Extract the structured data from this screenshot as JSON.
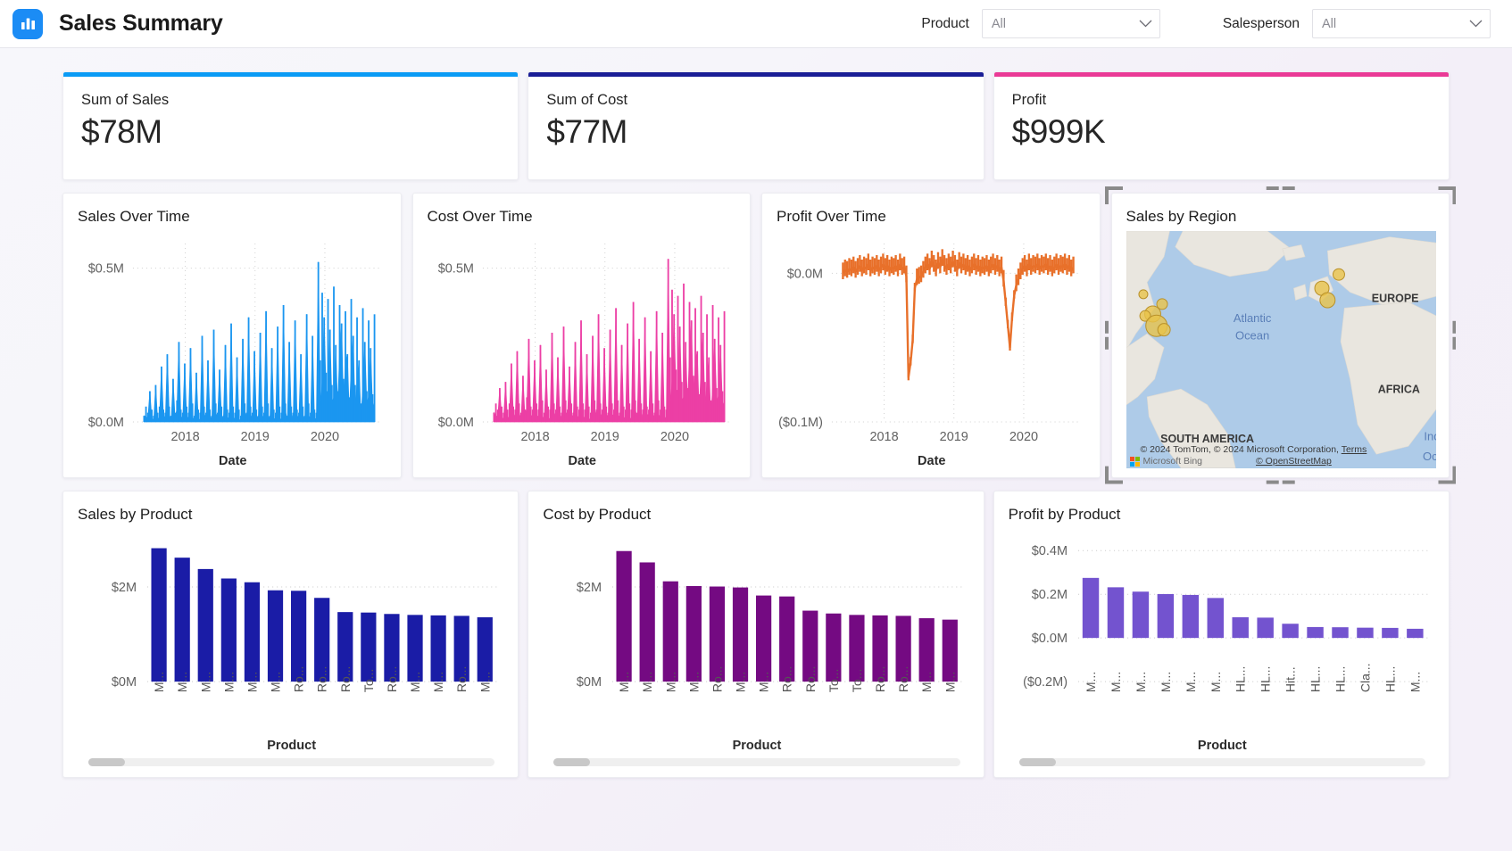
{
  "header": {
    "logo_icon": "bar-chart-icon",
    "title": "Sales Summary",
    "filters": [
      {
        "label": "Product",
        "value": "All",
        "chevron_icon": "chevron-down-icon"
      },
      {
        "label": "Salesperson",
        "value": "All",
        "chevron_icon": "chevron-down-icon"
      }
    ]
  },
  "kpis": [
    {
      "label": "Sum of Sales",
      "value": "$78M",
      "accent": "#0a9bf5"
    },
    {
      "label": "Sum of Cost",
      "value": "$77M",
      "accent": "#1a1e96"
    },
    {
      "label": "Profit",
      "value": "$999K",
      "accent": "#ea3a96"
    }
  ],
  "map": {
    "title": "Sales by Region",
    "labels": [
      "EUROPE",
      "AFRICA",
      "SOUTH AMERICA",
      "Atlantic Ocean",
      "Indian Ocean"
    ],
    "attribution_line1": "© 2024 TomTom, © 2024 Microsoft Corporation,",
    "attribution_terms": "Terms",
    "attribution_brand": "Microsoft Bing",
    "attribution_osm": "© OpenStreetMap",
    "selected": true
  },
  "chart_data": [
    {
      "id": "sales-over-time",
      "type": "area",
      "title": "Sales Over Time",
      "xlabel": "Date",
      "ylabel": "",
      "color": "#1b96f0",
      "yticks": [
        "$0.0M",
        "$0.5M"
      ],
      "ylim": [
        0,
        0.58
      ],
      "xticks": [
        "2018",
        "2019",
        "2020"
      ],
      "grid": true,
      "series_note": "daily sales, noisy, rising trend with spike near mid-2019",
      "values": [
        0.02,
        0.05,
        0.03,
        0.1,
        0.04,
        0.02,
        0.12,
        0.03,
        0.05,
        0.18,
        0.04,
        0.03,
        0.22,
        0.05,
        0.02,
        0.14,
        0.03,
        0.07,
        0.26,
        0.04,
        0.03,
        0.19,
        0.05,
        0.03,
        0.24,
        0.06,
        0.02,
        0.16,
        0.04,
        0.03,
        0.28,
        0.05,
        0.03,
        0.2,
        0.04,
        0.02,
        0.3,
        0.06,
        0.03,
        0.17,
        0.05,
        0.02,
        0.25,
        0.04,
        0.03,
        0.32,
        0.05,
        0.03,
        0.21,
        0.04,
        0.02,
        0.27,
        0.06,
        0.03,
        0.34,
        0.05,
        0.03,
        0.23,
        0.04,
        0.02,
        0.29,
        0.05,
        0.03,
        0.36,
        0.06,
        0.02,
        0.24,
        0.04,
        0.03,
        0.31,
        0.05,
        0.03,
        0.38,
        0.06,
        0.02,
        0.26,
        0.05,
        0.03,
        0.33,
        0.04,
        0.03,
        0.22,
        0.05,
        0.02,
        0.35,
        0.06,
        0.03,
        0.28,
        0.04,
        0.03,
        0.52,
        0.2,
        0.42,
        0.34,
        0.16,
        0.4,
        0.3,
        0.12,
        0.44,
        0.25,
        0.1,
        0.38,
        0.32,
        0.14,
        0.36,
        0.22,
        0.08,
        0.4,
        0.28,
        0.12,
        0.34,
        0.2,
        0.06,
        0.37,
        0.26,
        0.1,
        0.33,
        0.24,
        0.09,
        0.35
      ]
    },
    {
      "id": "cost-over-time",
      "type": "area",
      "title": "Cost Over Time",
      "xlabel": "Date",
      "ylabel": "",
      "color": "#ec3fa5",
      "yticks": [
        "$0.0M",
        "$0.5M"
      ],
      "ylim": [
        0,
        0.58
      ],
      "xticks": [
        "2018",
        "2019",
        "2020"
      ],
      "grid": true,
      "series_note": "daily cost, noisy, similar shape to sales with spike near mid-2019",
      "values": [
        0.03,
        0.06,
        0.04,
        0.11,
        0.05,
        0.03,
        0.13,
        0.04,
        0.06,
        0.19,
        0.05,
        0.04,
        0.23,
        0.06,
        0.03,
        0.15,
        0.04,
        0.08,
        0.27,
        0.05,
        0.04,
        0.2,
        0.06,
        0.04,
        0.25,
        0.07,
        0.03,
        0.17,
        0.05,
        0.04,
        0.29,
        0.06,
        0.04,
        0.21,
        0.05,
        0.03,
        0.31,
        0.07,
        0.04,
        0.18,
        0.06,
        0.03,
        0.26,
        0.05,
        0.04,
        0.33,
        0.06,
        0.04,
        0.22,
        0.05,
        0.03,
        0.28,
        0.07,
        0.04,
        0.35,
        0.06,
        0.04,
        0.24,
        0.05,
        0.03,
        0.3,
        0.06,
        0.04,
        0.37,
        0.07,
        0.03,
        0.25,
        0.05,
        0.04,
        0.32,
        0.06,
        0.04,
        0.39,
        0.07,
        0.03,
        0.27,
        0.06,
        0.04,
        0.34,
        0.05,
        0.04,
        0.23,
        0.06,
        0.03,
        0.36,
        0.07,
        0.04,
        0.29,
        0.05,
        0.04,
        0.53,
        0.21,
        0.43,
        0.35,
        0.17,
        0.41,
        0.31,
        0.13,
        0.45,
        0.26,
        0.11,
        0.39,
        0.33,
        0.15,
        0.37,
        0.23,
        0.09,
        0.41,
        0.29,
        0.13,
        0.35,
        0.21,
        0.07,
        0.38,
        0.27,
        0.11,
        0.34,
        0.25,
        0.1,
        0.36
      ]
    },
    {
      "id": "profit-over-time",
      "type": "line",
      "title": "Profit Over Time",
      "xlabel": "Date",
      "ylabel": "",
      "color": "#e8702a",
      "yticks": [
        "($0.1M)",
        "$0.0M"
      ],
      "ylim": [
        -0.1,
        0.02
      ],
      "xticks": [
        "2018",
        "2019",
        "2020"
      ],
      "grid": true,
      "series_note": "daily profit near zero with two deep negative drawdowns (mid-2018 and late-2019)",
      "values": [
        0.0,
        0.002,
        0.001,
        0.003,
        0.002,
        0.004,
        0.001,
        0.003,
        0.005,
        0.002,
        0.004,
        0.003,
        0.006,
        0.002,
        0.004,
        0.003,
        0.005,
        0.002,
        0.004,
        0.006,
        0.003,
        0.005,
        0.002,
        0.004,
        0.003,
        0.005,
        0.002,
        0.006,
        0.003,
        0.004,
        -0.002,
        -0.07,
        -0.06,
        -0.045,
        -0.01,
        -0.004,
        -0.003,
        -0.002,
        0.001,
        0.004,
        0.006,
        0.003,
        0.008,
        0.005,
        0.002,
        0.007,
        0.004,
        0.009,
        0.005,
        0.003,
        0.006,
        0.004,
        0.008,
        0.005,
        0.002,
        0.007,
        0.004,
        0.006,
        0.003,
        0.005,
        0.002,
        0.004,
        0.006,
        0.003,
        0.005,
        0.002,
        0.004,
        0.003,
        0.005,
        0.002,
        0.004,
        0.006,
        0.003,
        0.005,
        0.002,
        0.004,
        -0.005,
        -0.02,
        -0.035,
        -0.05,
        -0.03,
        -0.015,
        -0.008,
        -0.004,
        0.0,
        0.003,
        0.005,
        0.002,
        0.006,
        0.003,
        0.005,
        0.004,
        0.006,
        0.003,
        0.005,
        0.004,
        0.006,
        0.003,
        0.005,
        0.002,
        0.004,
        0.006,
        0.003,
        0.005,
        0.004,
        0.006,
        0.003,
        0.005,
        0.002,
        0.004
      ]
    },
    {
      "id": "sales-by-product",
      "type": "bar",
      "title": "Sales by Product",
      "xlabel": "Product",
      "ylabel": "",
      "color": "#1a1ca6",
      "yticks": [
        "$0M",
        "$2M"
      ],
      "ylim": [
        0,
        3.0
      ],
      "categories": [
        "M...",
        "M...",
        "M...",
        "M...",
        "M...",
        "M...",
        "Ro...",
        "Ro...",
        "Ro...",
        "To...",
        "Ro...",
        "M...",
        "M...",
        "Ro...",
        "M..."
      ],
      "values": [
        2.82,
        2.62,
        2.38,
        2.18,
        2.1,
        1.93,
        1.92,
        1.77,
        1.47,
        1.46,
        1.43,
        1.41,
        1.4,
        1.39,
        1.36
      ],
      "grid": true,
      "has_scrollbar": true
    },
    {
      "id": "cost-by-product",
      "type": "bar",
      "title": "Cost by Product",
      "xlabel": "Product",
      "ylabel": "",
      "color": "#740a82",
      "yticks": [
        "$0M",
        "$2M"
      ],
      "ylim": [
        0,
        3.0
      ],
      "categories": [
        "M...",
        "M...",
        "M...",
        "M...",
        "Ro...",
        "M...",
        "M...",
        "Ro...",
        "Ro...",
        "To...",
        "To...",
        "Ro...",
        "Ro...",
        "M...",
        "M..."
      ],
      "values": [
        2.76,
        2.52,
        2.12,
        2.02,
        2.01,
        1.99,
        1.82,
        1.8,
        1.5,
        1.44,
        1.41,
        1.4,
        1.39,
        1.34,
        1.31
      ],
      "grid": true,
      "has_scrollbar": true
    },
    {
      "id": "profit-by-product",
      "type": "bar",
      "title": "Profit by Product",
      "xlabel": "Product",
      "ylabel": "",
      "color": "#7353cf",
      "yticks": [
        "($0.2M)",
        "$0.0M",
        "$0.2M",
        "$0.4M"
      ],
      "ylim": [
        -0.2,
        0.45
      ],
      "categories": [
        "M...",
        "M...",
        "M...",
        "M...",
        "M...",
        "M...",
        "HL...",
        "HL...",
        "Hit...",
        "HL...",
        "HL...",
        "Cla...",
        "HL...",
        "M..."
      ],
      "values": [
        0.275,
        0.232,
        0.212,
        0.201,
        0.197,
        0.183,
        0.095,
        0.093,
        0.065,
        0.05,
        0.049,
        0.047,
        0.046,
        0.042
      ],
      "grid": true,
      "has_scrollbar": true
    }
  ]
}
